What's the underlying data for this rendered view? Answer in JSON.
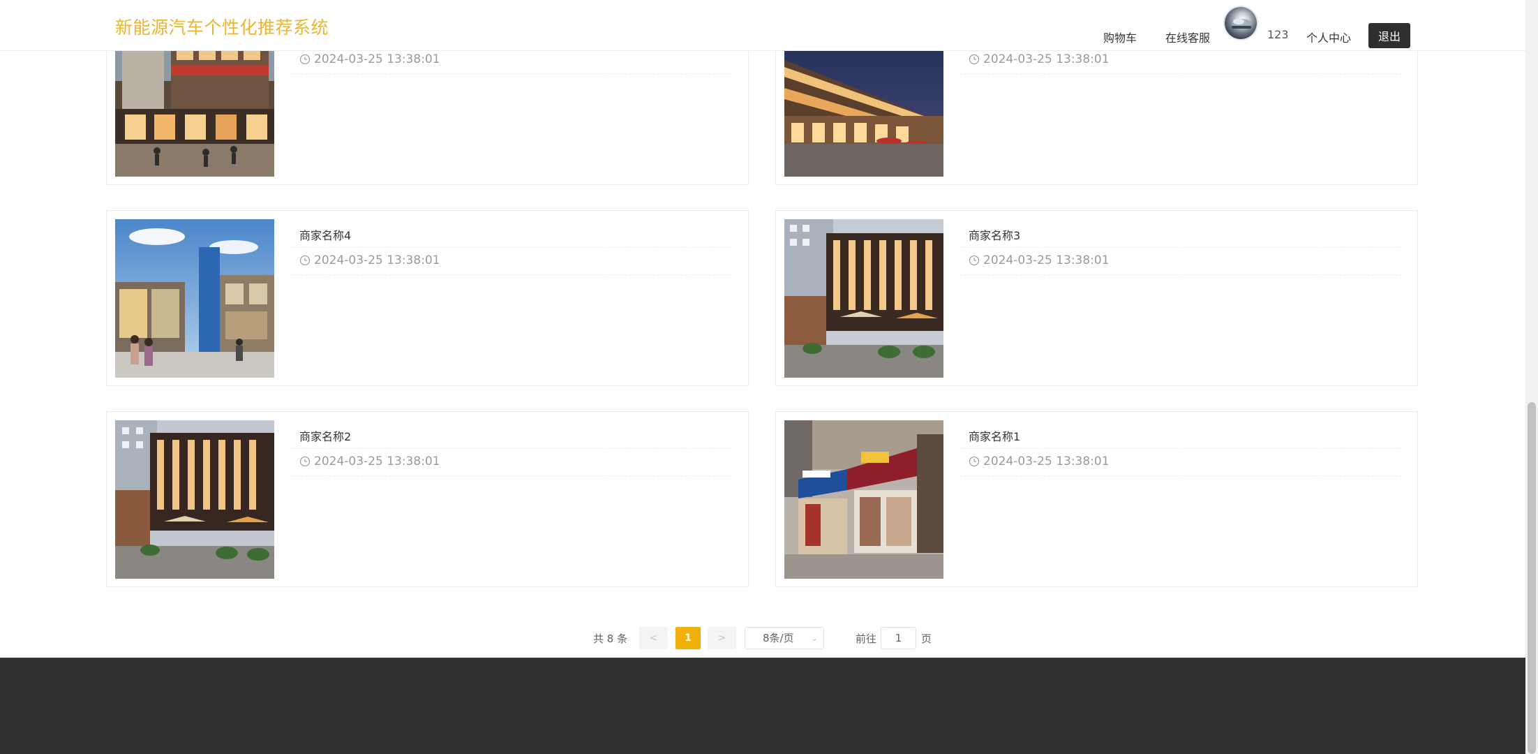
{
  "header": {
    "brand": "新能源汽车个性化推荐系统",
    "nav": {
      "cart": "购物车",
      "service": "在线客服",
      "username": "123",
      "profile": "个人中心",
      "logout": "退出"
    }
  },
  "cards": [
    {
      "title": "",
      "date": "2024-03-25 13:38:01"
    },
    {
      "title": "",
      "date": "2024-03-25 13:38:01"
    },
    {
      "title": "商家名称4",
      "date": "2024-03-25 13:38:01"
    },
    {
      "title": "商家名称3",
      "date": "2024-03-25 13:38:01"
    },
    {
      "title": "商家名称2",
      "date": "2024-03-25 13:38:01"
    },
    {
      "title": "商家名称1",
      "date": "2024-03-25 13:38:01"
    }
  ],
  "pagination": {
    "total_text": "共 8 条",
    "prev": "<",
    "current": "1",
    "next": ">",
    "page_size": "8条/页",
    "goto_label": "前往",
    "goto_value": "1",
    "unit": "页"
  },
  "colors": {
    "brand": "#e9b62f",
    "active_page": "#f2b10a",
    "footer": "#323232"
  }
}
